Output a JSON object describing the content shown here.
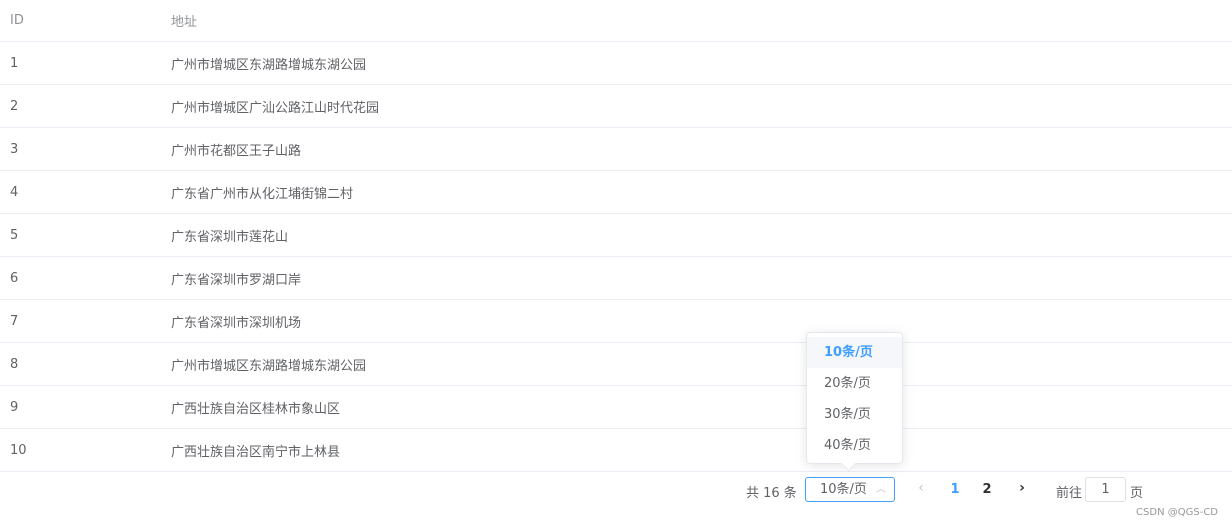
{
  "table": {
    "headers": {
      "id": "ID",
      "address": "地址"
    },
    "rows": [
      {
        "id": "1",
        "address": "广州市增城区东湖路增城东湖公园"
      },
      {
        "id": "2",
        "address": "广州市增城区广汕公路江山时代花园"
      },
      {
        "id": "3",
        "address": "广州市花都区王子山路"
      },
      {
        "id": "4",
        "address": "广东省广州市从化江埔街锦二村"
      },
      {
        "id": "5",
        "address": "广东省深圳市莲花山"
      },
      {
        "id": "6",
        "address": "广东省深圳市罗湖口岸"
      },
      {
        "id": "7",
        "address": "广东省深圳市深圳机场"
      },
      {
        "id": "8",
        "address": "广州市增城区东湖路增城东湖公园"
      },
      {
        "id": "9",
        "address": "广西壮族自治区桂林市象山区"
      },
      {
        "id": "10",
        "address": "广西壮族自治区南宁市上林县"
      }
    ]
  },
  "pagination": {
    "total_text": "共 16 条",
    "page_size_selected": "10条/页",
    "page_size_options": [
      "10条/页",
      "20条/页",
      "30条/页",
      "40条/页"
    ],
    "prev_icon": "chevron-left-icon",
    "next_icon": "chevron-right-icon",
    "pages": [
      "1",
      "2"
    ],
    "current_page": "1",
    "goto_label": "前往",
    "goto_value": "1",
    "goto_suffix": "页"
  },
  "watermark": "CSDN @QGS-CD",
  "colors": {
    "accent": "#409eff",
    "text": "#606266",
    "border": "#ebeef5"
  }
}
